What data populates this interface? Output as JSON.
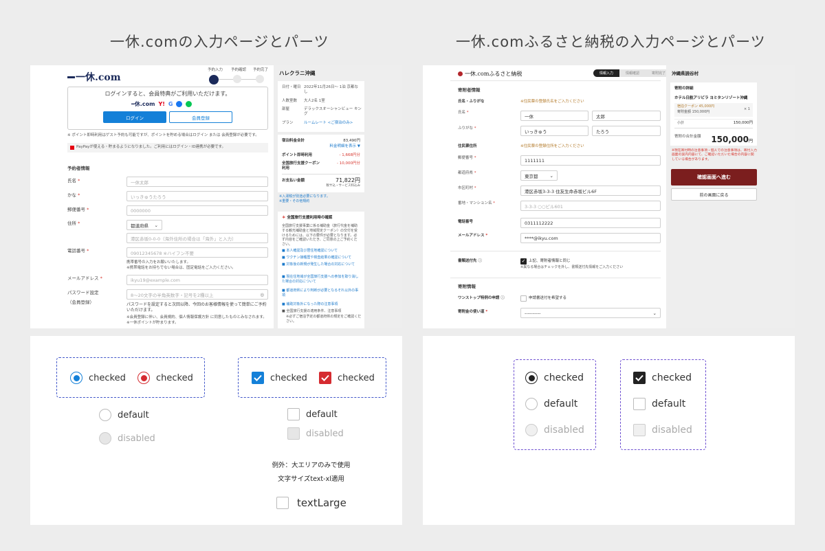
{
  "titles": {
    "left": "一休.comの入力ページとパーツ",
    "right": "一休.comふるさと納税の入力ページとパーツ"
  },
  "left_form": {
    "logo": "一休.com",
    "steps": [
      "予約入力",
      "予約確認",
      "予約完了"
    ],
    "login_prompt": "ログインすると、会員特典がご利用いただけます。",
    "login_button": "ログイン",
    "register_button": "会員登録",
    "point_note": "※ ポイント即時利用はゲスト予約も可能ですが、ポイントを貯める場合はログイン または 会員登録が必要です。",
    "paypay_note": "PayPayが使える・貯まるようになりました。ご利用にはログイン・ID連携が必要です。",
    "section_title": "予約者情報",
    "fields": [
      {
        "label": "氏名",
        "required": true,
        "placeholder": "一休太郎"
      },
      {
        "label": "かな",
        "required": true,
        "placeholder": "いっきゅうたろう"
      },
      {
        "label": "郵便番号",
        "required": true,
        "placeholder": "0000000"
      },
      {
        "label": "住所",
        "required": true,
        "placeholder": "都道府県"
      },
      {
        "label": "",
        "required": false,
        "placeholder": "港区赤坂0-0-0（海外住所の場合は「海外」と入力）"
      },
      {
        "label": "電話番号",
        "required": true,
        "placeholder": "09012345678 ※ハイフン不要"
      },
      {
        "label": "メールアドレス",
        "required": true,
        "placeholder": "ikyu19@example.com"
      },
      {
        "label": "パスワード設定",
        "required": false,
        "placeholder": "8〜20文字の半角英数字・記号を2種以上"
      }
    ],
    "phone_note1": "携帯番号の入力をお願いいたします。",
    "phone_note2": "※携帯電話をお持ちでない場合は、固定電話をご入力ください。",
    "member_reg": "（会員登録）",
    "password_note": "パスワードを設定すると次回以降、今回のお客様情報を使って簡単にご予約いただけます。",
    "terms_note": "※会員登録に伴い、会員規約、個人情報保護方針 に同意したものとみなされます。",
    "point_note2": "※一休ポイントが貯まります。"
  },
  "left_side": {
    "hotel": "ハレクラニ沖縄",
    "rows": [
      {
        "k": "日付・曜日",
        "v": "2022年11月26日〜 1泊 京都なし"
      },
      {
        "k": "人数室数",
        "v": "大人2名 1室"
      },
      {
        "k": "部屋",
        "v": "デラックスオーシャンビュー キング"
      },
      {
        "k": "プラン",
        "v": "ルームレート <ご宿泊のみ>"
      }
    ],
    "total_label": "宿泊料金合計",
    "total_value": "83,490円",
    "total_link": "料金明細を表示 ▼",
    "point_label": "ポイント即時利用",
    "point_value": "- 1,668円分",
    "support_label": "全国旅行支援クーポン利用",
    "support_value": "- 10,000円分",
    "pay_label": "お支払い金額",
    "pay_value": "71,822円",
    "pay_note": "税サ込・サービス料込み",
    "notes": [
      "※入湯税が別途必要になります。",
      "※重要・その他規約"
    ],
    "campaign_title": "全国旅行支援利用時の確認",
    "campaign_text": "全国旅行支援事業に係る補助金（旅行代金を補助する観光補助金と地域限定クーポン）の交付を受けるためには、以下の要件が必要となります。必ず内容をご確認いただき、ご同意の上ご予約ください。",
    "campaign_items": [
      "本人確認及び居住地確認について",
      "ワクチン接種歴や検査結果の確認について",
      "対象後の新規が発生した場合の対応について",
      "現在住地域が全国旅行支援への参加を取り消した場合の対応について",
      "都道府県により判断が必要となるそれ以外の事項",
      "補助対象外になった際の注意事項",
      "全国旅行支援の適用条件、注意事項"
    ],
    "campaign_foot": "※必ずご宿泊予定の都道府県の規定をご確認ください。"
  },
  "right_form": {
    "logo": "一休.comふるさと納税",
    "steps": [
      "情報入力",
      "情報確認",
      "寄附完了"
    ],
    "section1": "寄附者情報",
    "name_row": "氏名・ふりがな",
    "name_note": "※住民票の登録氏名をご入力ください",
    "fields": [
      {
        "label": "氏名",
        "required": true,
        "value": "一休",
        "value2": "太郎"
      },
      {
        "label": "ふりがな",
        "required": true,
        "value": "いっきゅう",
        "value2": "たろう"
      }
    ],
    "section2": "住民票住所",
    "address_note": "※住民票の登録住所をご入力ください",
    "postal_label": "郵便番号",
    "postal": "1111111",
    "pref_label": "都道府県",
    "pref": "東京都",
    "city_label": "市区町村",
    "city": "港区赤坂3-3-3 住友生命赤坂ビル6F",
    "building_label": "番地・マンション名",
    "building": "3-3-3 ○○ビル601",
    "phone_label": "電話番号",
    "phone": "0311112222",
    "email_label": "メールアドレス",
    "email": "****@ikyu.com",
    "send_label": "書類送付先",
    "send_option": "上記、寄附者情報と同じ",
    "send_note": "※異なる場合はチェックを外し、書類送付先情報をご入力ください",
    "section3": "寄附情報",
    "onestop_label": "ワンストップ特例の申請",
    "onestop_option": "申請書送付を希望する",
    "usage_label": "寄附金の使い道",
    "usage_value": "----------"
  },
  "right_side": {
    "municipality": "沖縄県読谷村",
    "detail_title": "寄附の詳細",
    "hotel": "ホテル日航アリビラ ヨミタンリゾート沖縄",
    "coupon": "宿泊クーポン 45,000円",
    "amount_line": "寄附金額 150,000円",
    "qty": "× 1",
    "subtotal_label": "小計",
    "subtotal": "150,000円",
    "total_label": "寄附の合計金額",
    "total": "150,000",
    "total_unit": "円",
    "warn": "※現在寄付時の注意事項・個人での注意事項は、寄付入力画面の案内内容にて、ご確認いただいた場合の内容に関している場合があります。",
    "confirm_button": "確認画面へ進む",
    "back_button": "前の画面に戻る"
  },
  "parts_left": {
    "checked": "checked",
    "default": "default",
    "disabled": "disabled",
    "exception_line1": "例外：大エリアのみで使用",
    "exception_line2": "文字サイズtext-xl適用",
    "text_large": "textLarge"
  },
  "parts_right": {
    "checked": "checked",
    "default": "default",
    "disabled": "disabled"
  },
  "colors": {
    "ikyu_blue": "#1480d8",
    "ikyu_red": "#d52b30",
    "furusato_dark": "#222222",
    "furusato_button": "#7b1e1e"
  }
}
